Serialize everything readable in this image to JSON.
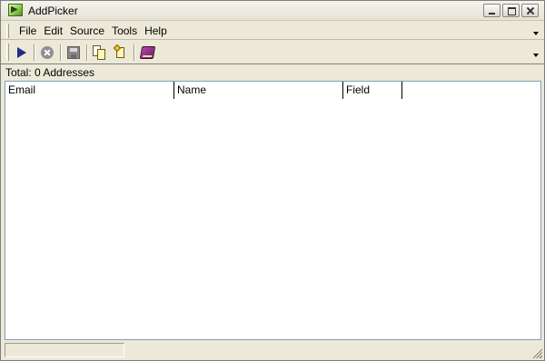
{
  "window": {
    "title": "AddPicker"
  },
  "menu": {
    "items": [
      {
        "label": "File"
      },
      {
        "label": "Edit"
      },
      {
        "label": "Source"
      },
      {
        "label": "Tools"
      },
      {
        "label": "Help"
      }
    ]
  },
  "toolbar": {
    "buttons": [
      {
        "icon": "play-icon"
      },
      {
        "icon": "stop-icon"
      },
      {
        "icon": "save-icon"
      },
      {
        "icon": "copy-icon"
      },
      {
        "icon": "paste-icon"
      },
      {
        "icon": "address-book-icon"
      }
    ]
  },
  "summary": {
    "total_text": "Total: 0 Addresses"
  },
  "list": {
    "columns": [
      "Email",
      "Name",
      "Field"
    ],
    "rows": []
  },
  "status": {
    "text": ""
  }
}
